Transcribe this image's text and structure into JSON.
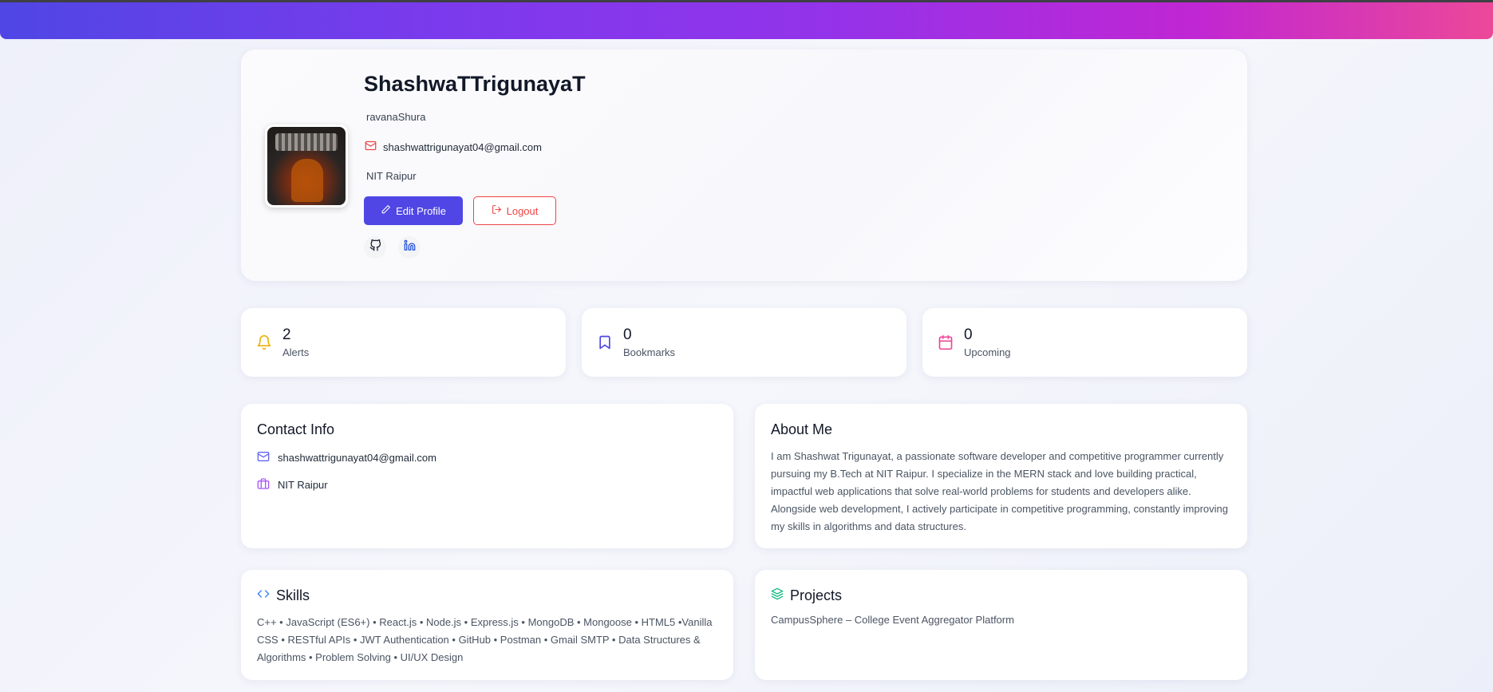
{
  "profile": {
    "name": "ShashwaTTrigunayaT",
    "username": "ravanaShura",
    "email": "shashwattrigunayat04@gmail.com",
    "college": "NIT Raipur",
    "edit_label": "Edit Profile",
    "logout_label": "Logout"
  },
  "stats": [
    {
      "value": "2",
      "label": "Alerts",
      "icon": "bell-icon",
      "color": "#eab308"
    },
    {
      "value": "0",
      "label": "Bookmarks",
      "icon": "bookmark-icon",
      "color": "#4f46e5"
    },
    {
      "value": "0",
      "label": "Upcoming",
      "icon": "calendar-icon",
      "color": "#ec4899"
    }
  ],
  "contact": {
    "title": "Contact Info",
    "email": "shashwattrigunayat04@gmail.com",
    "college": "NIT Raipur"
  },
  "about": {
    "title": "About Me",
    "text": "I am Shashwat Trigunayat, a passionate software developer and competitive programmer currently pursuing my B.Tech at NIT Raipur. I specialize in the MERN stack and love building practical, impactful web applications that solve real-world problems for students and developers alike. Alongside web development, I actively participate in competitive programming, constantly improving my skills in algorithms and data structures."
  },
  "skills": {
    "title": "Skills",
    "text": "C++ • JavaScript (ES6+) • React.js • Node.js • Express.js • MongoDB • Mongoose • HTML5 •Vanilla CSS • RESTful APIs • JWT Authentication • GitHub • Postman • Gmail SMTP • Data Structures & Algorithms • Problem Solving • UI/UX Design"
  },
  "projects": {
    "title": "Projects",
    "text": "CampusSphere – College Event Aggregator Platform"
  },
  "colors": {
    "accent": "#4f46e5",
    "danger": "#ef4444",
    "header_gradient": [
      "#4f46e5",
      "#9333ea",
      "#ec4899"
    ]
  }
}
